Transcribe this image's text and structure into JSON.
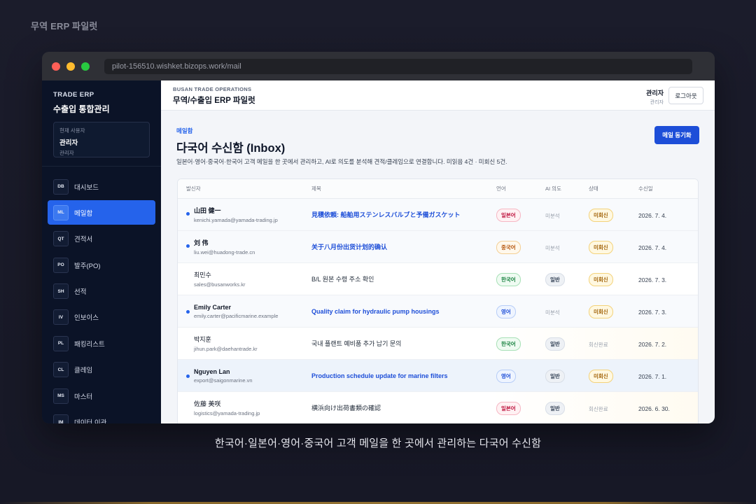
{
  "page": {
    "caption_top": "무역 ERP 파일럿",
    "caption_bottom": "한국어·일본어·영어·중국어 고객 메일을 한 곳에서 관리하는 다국어 수신함"
  },
  "browser": {
    "url": "pilot-156510.wishket.bizops.work/mail"
  },
  "sidebar": {
    "brand_small": "TRADE ERP",
    "brand_main": "수출입 통합관리",
    "user_card": {
      "label": "현재 사용자",
      "name": "관리자",
      "role": "관리자"
    },
    "items": [
      {
        "code": "DB",
        "label": "대시보드"
      },
      {
        "code": "ML",
        "label": "메일함",
        "active": true
      },
      {
        "code": "QT",
        "label": "견적서"
      },
      {
        "code": "PO",
        "label": "발주(PO)"
      },
      {
        "code": "SH",
        "label": "선적"
      },
      {
        "code": "IV",
        "label": "인보이스"
      },
      {
        "code": "PL",
        "label": "패킹리스트"
      },
      {
        "code": "CL",
        "label": "클레임"
      },
      {
        "code": "MS",
        "label": "마스터"
      },
      {
        "code": "IM",
        "label": "데이터 이관"
      }
    ]
  },
  "header": {
    "sub": "BUSAN TRADE OPERATIONS",
    "title": "무역/수출입 ERP 파일럿",
    "user_name": "관리자",
    "user_role": "관리자",
    "logout_label": "로그아웃"
  },
  "main": {
    "section_tag": "메일함",
    "title": "다국어 수신함 (Inbox)",
    "description": "일본어·영어·중국어·한국어 고객 메일을 한 곳에서 관리하고, AI로 의도를 분석해 견적/클레임으로 연결합니다. 미읽음 4건 · 미회신 5건.",
    "sync_label": "메일 동기화"
  },
  "table": {
    "headers": [
      "발신자",
      "제목",
      "언어",
      "AI 의도",
      "상태",
      "수신일"
    ],
    "rows": [
      {
        "name": "山田 健一",
        "email": "kenichi.yamada@yamada-trading.jp",
        "subject": "見積依頼: 船舶用ステンレスバルブと予備ガスケット",
        "lang": "일본어",
        "lang_class": "ja",
        "ai": "미분석",
        "status": "미회신",
        "date": "2026. 7. 4.",
        "unread": true,
        "style": "unread"
      },
      {
        "name": "刘 伟",
        "email": "liu.wei@huadong-trade.cn",
        "subject": "关于八月份出货计划的确认",
        "lang": "중국어",
        "lang_class": "zh",
        "ai": "미분석",
        "status": "미회신",
        "date": "2026. 7. 4.",
        "unread": true,
        "style": "unread"
      },
      {
        "name": "최민수",
        "email": "sales@busanworks.kr",
        "subject": "B/L 원본 수령 주소 확인",
        "lang": "한국어",
        "lang_class": "ko",
        "ai": "일반",
        "status": "미회신",
        "date": "2026. 7. 3.",
        "unread": false,
        "style": "plain"
      },
      {
        "name": "Emily Carter",
        "email": "emily.carter@pacificmarine.example",
        "subject": "Quality claim for hydraulic pump housings",
        "lang": "영어",
        "lang_class": "en",
        "ai": "미분석",
        "status": "미회신",
        "date": "2026. 7. 3.",
        "unread": true,
        "style": "unread"
      },
      {
        "name": "박지훈",
        "email": "jihun.park@daehantrade.kr",
        "subject": "국내 플랜트 예비품 추가 납기 문의",
        "lang": "한국어",
        "lang_class": "ko",
        "ai": "일반",
        "status": "회신완료",
        "date": "2026. 7. 2.",
        "unread": false,
        "style": "warm"
      },
      {
        "name": "Nguyen Lan",
        "email": "export@saigonmarine.vn",
        "subject": "Production schedule update for marine filters",
        "lang": "영어",
        "lang_class": "en",
        "ai": "일반",
        "status": "미회신",
        "date": "2026. 7. 1.",
        "unread": true,
        "style": "selected"
      },
      {
        "name": "佐藤 美咲",
        "email": "logistics@yamada-trading.jp",
        "subject": "横浜向け出荷書類の確認",
        "lang": "일본어",
        "lang_class": "ja",
        "ai": "일반",
        "status": "회신완료",
        "date": "2026. 6. 30.",
        "unread": false,
        "style": "warm"
      }
    ]
  }
}
